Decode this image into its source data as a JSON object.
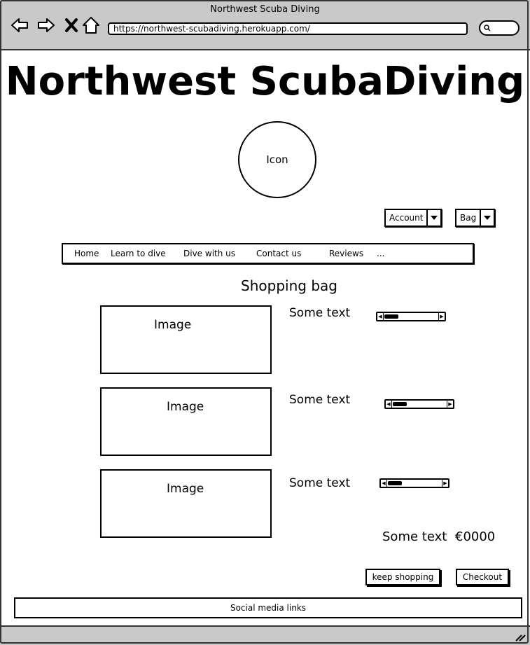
{
  "browser": {
    "window_title": "Northwest Scuba Diving",
    "url": "https://northwest-scubadiving.herokuapp.com/"
  },
  "header": {
    "site_title": "Northwest ScubaDiving",
    "logo_label": "Icon"
  },
  "account_menu": {
    "label": "Account"
  },
  "bag_menu": {
    "label": "Bag"
  },
  "nav": {
    "items": [
      "Home",
      "Learn to dive",
      "Dive with us",
      "Contact us",
      "Reviews",
      "..."
    ]
  },
  "main": {
    "title": "Shopping bag",
    "items": [
      {
        "image_label": "Image",
        "text": "Some text"
      },
      {
        "image_label": "Image",
        "text": "Some text"
      },
      {
        "image_label": "Image",
        "text": "Some text"
      }
    ],
    "total_label": "Some text",
    "total_value": "€0000"
  },
  "actions": {
    "keep_shopping": "keep shopping",
    "checkout": "Checkout"
  },
  "footer": {
    "label": "Social media links"
  }
}
